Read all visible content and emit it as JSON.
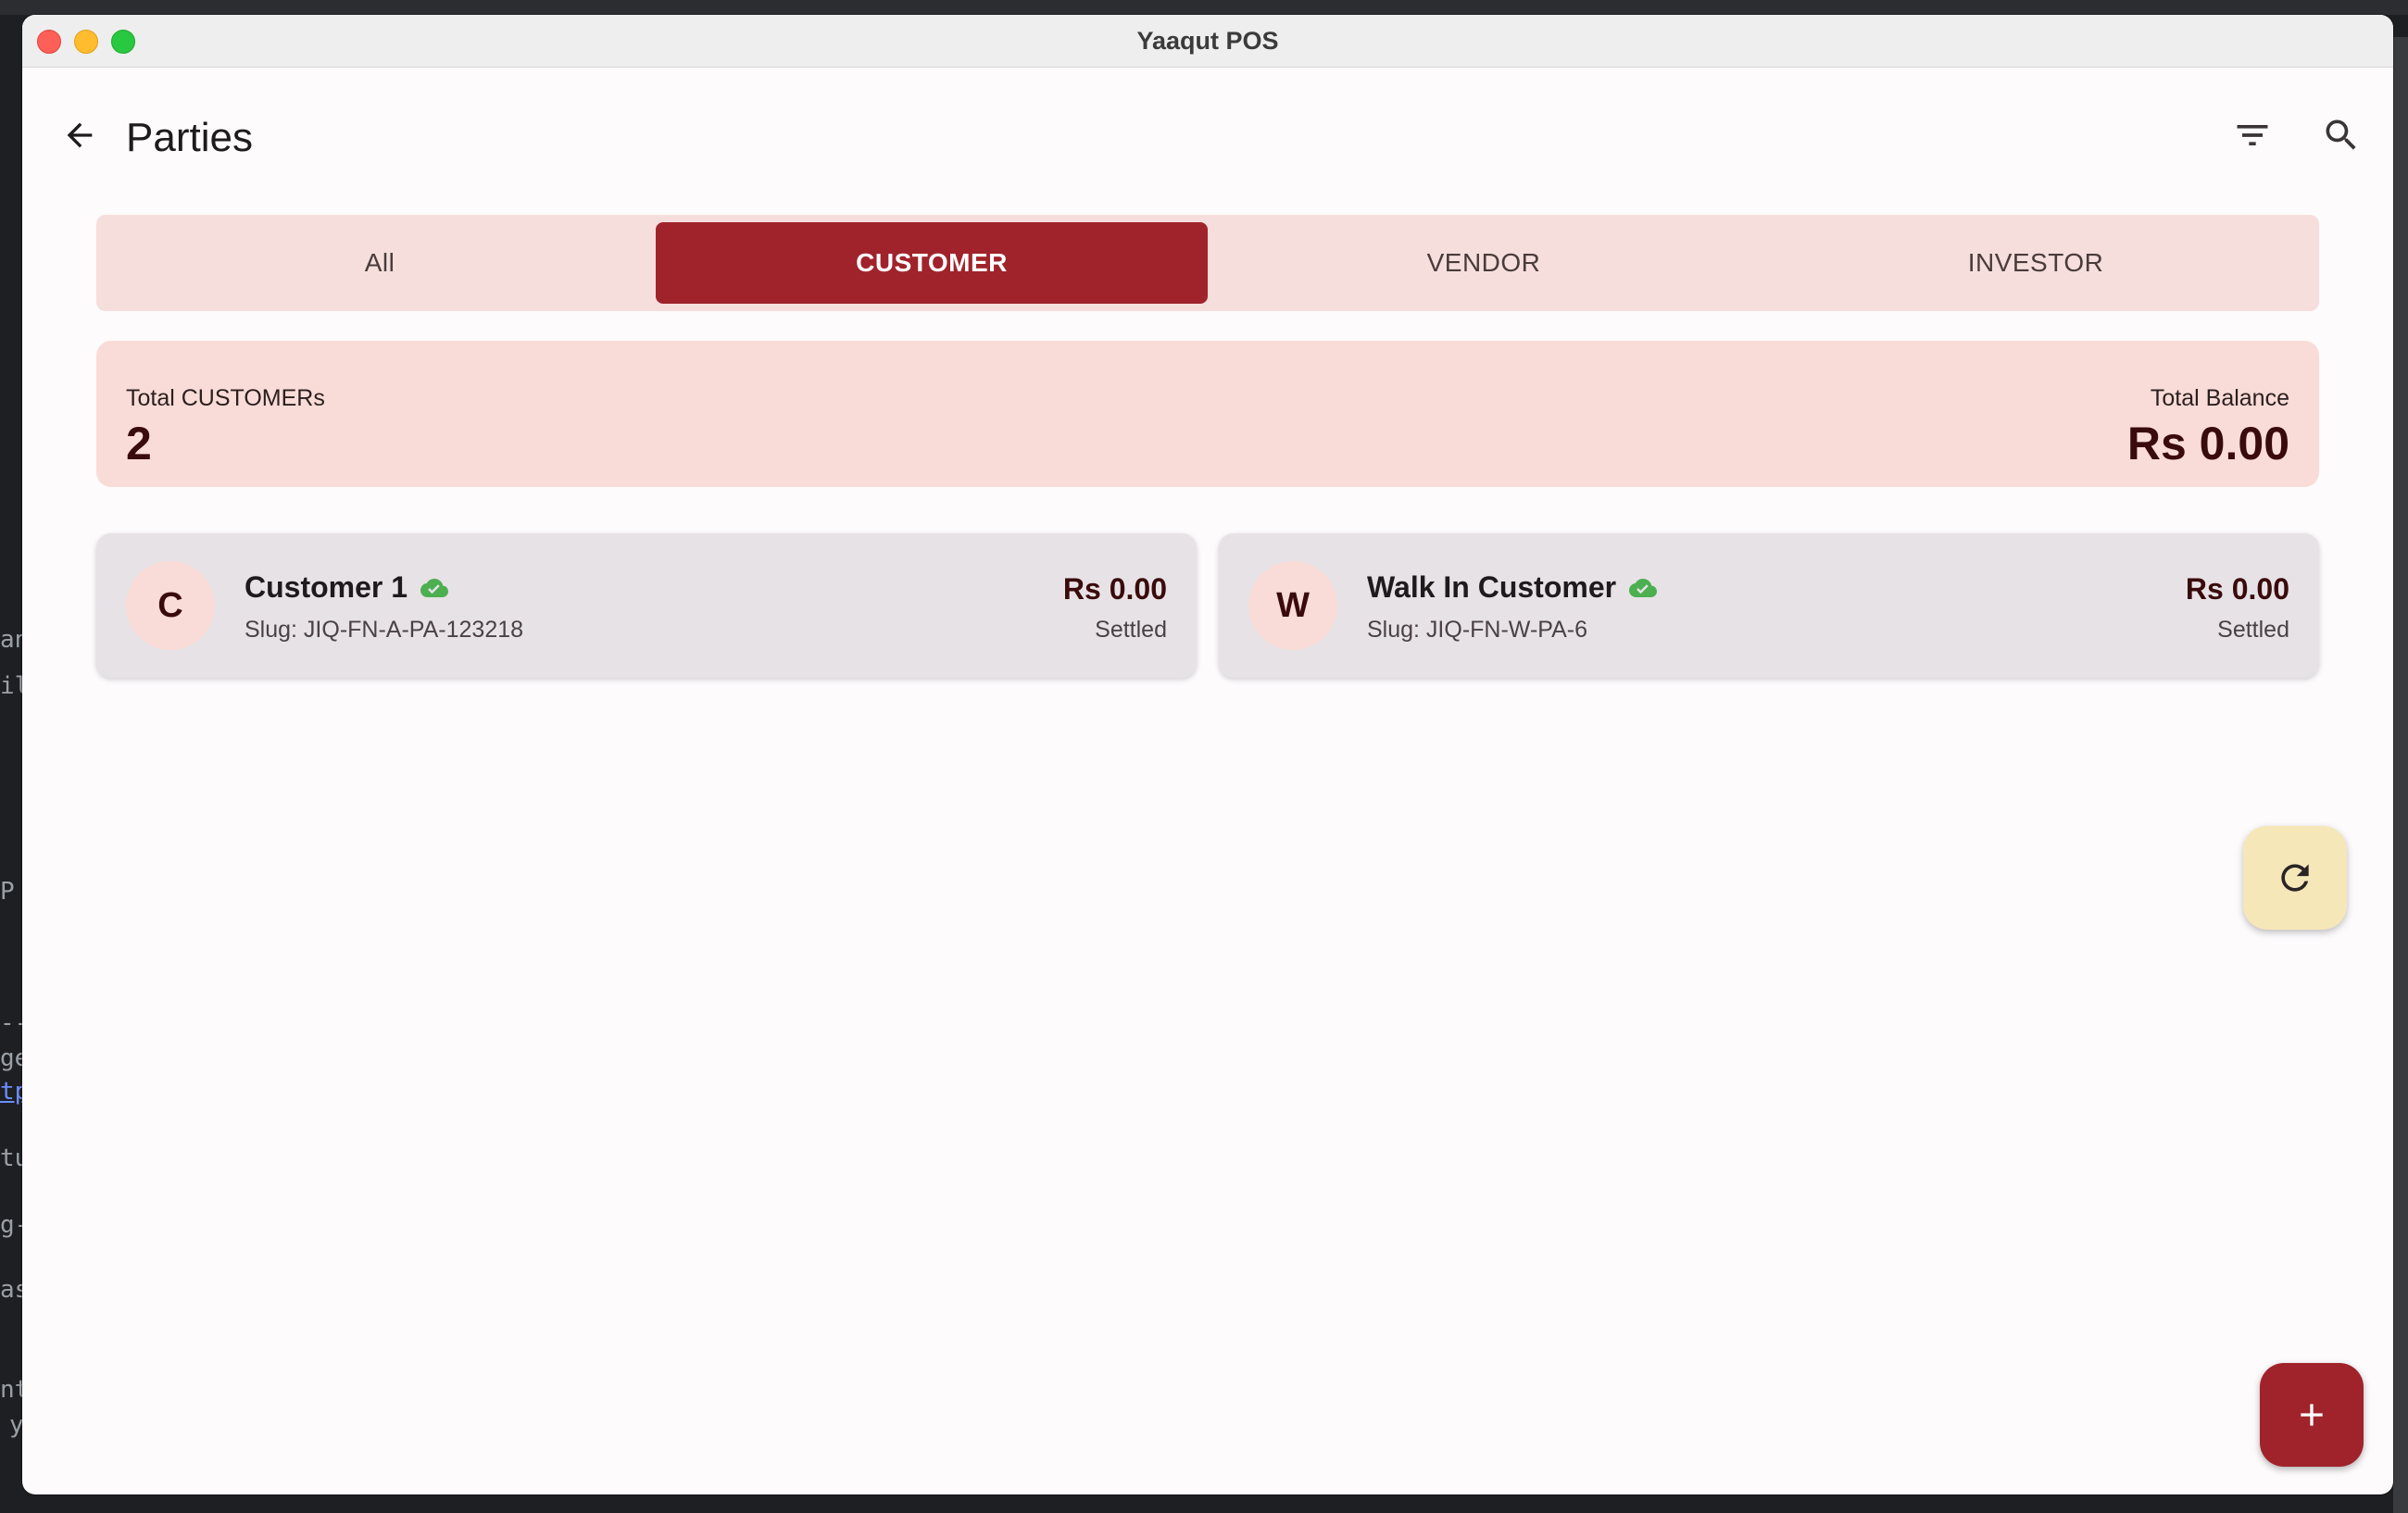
{
  "window": {
    "title": "Yaaqut POS"
  },
  "app_bar": {
    "title": "Parties",
    "back_icon": "arrow-left-icon",
    "filter_icon": "filter-icon",
    "search_icon": "search-icon"
  },
  "tabs": [
    {
      "label": "All",
      "active": false
    },
    {
      "label": "CUSTOMER",
      "active": true
    },
    {
      "label": "VENDOR",
      "active": false
    },
    {
      "label": "INVESTOR",
      "active": false
    }
  ],
  "summary": {
    "count_label": "Total CUSTOMERs",
    "count_value": "2",
    "balance_label": "Total Balance",
    "balance_value": "Rs 0.00"
  },
  "parties": [
    {
      "initial": "C",
      "name": "Customer 1",
      "slug": "Slug: JIQ-FN-A-PA-123218",
      "amount": "Rs 0.00",
      "status": "Settled",
      "sync_icon": "cloud-done-icon"
    },
    {
      "initial": "W",
      "name": "Walk In Customer",
      "slug": "Slug: JIQ-FN-W-PA-6",
      "amount": "Rs 0.00",
      "status": "Settled",
      "sync_icon": "cloud-done-icon"
    }
  ],
  "fabs": {
    "refresh_icon": "refresh-icon",
    "add_icon": "plus-icon"
  },
  "colors": {
    "primary": "#a0232b",
    "tab_bg": "#f5dedc",
    "summary_bg": "#f9dcd7",
    "card_bg": "#e7e2e6",
    "refresh_fab": "#f6e7b8",
    "sync_green": "#4caf50"
  },
  "background": {
    "fragments": [
      "an",
      "il",
      "P",
      "--",
      "ge",
      "tp",
      "tu",
      "g-",
      "as",
      "nt",
      "y"
    ]
  }
}
